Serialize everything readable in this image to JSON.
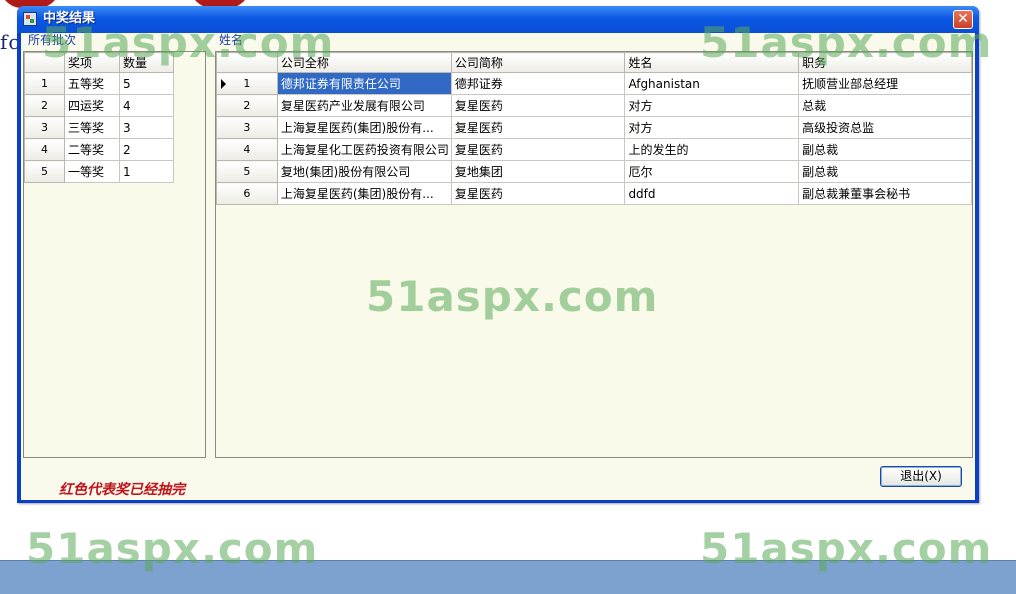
{
  "background": {
    "partial_text": "fc",
    "watermark": "51aspx.com"
  },
  "window": {
    "title": "中奖结果",
    "close_glyph": "✕"
  },
  "labels": {
    "batches": "所有批次",
    "names": "姓名"
  },
  "prize_grid": {
    "columns": [
      "奖项",
      "数量"
    ],
    "rows": [
      {
        "num": "1",
        "prize": "五等奖",
        "count": "5"
      },
      {
        "num": "2",
        "prize": "四运奖",
        "count": "4"
      },
      {
        "num": "3",
        "prize": "三等奖",
        "count": "3"
      },
      {
        "num": "4",
        "prize": "二等奖",
        "count": "2"
      },
      {
        "num": "5",
        "prize": "一等奖",
        "count": "1"
      }
    ]
  },
  "winner_grid": {
    "columns": [
      "公司全称",
      "公司简称",
      "姓名",
      "职务"
    ],
    "rows": [
      {
        "num": "1",
        "full": "德邦证券有限责任公司",
        "short": "德邦证券",
        "name": "Afghanistan",
        "title": "抚顺营业部总经理"
      },
      {
        "num": "2",
        "full": "复星医药产业发展有限公司",
        "short": "复星医药",
        "name": "对方",
        "title": "总裁"
      },
      {
        "num": "3",
        "full": "上海复星医药(集团)股份有...",
        "short": "复星医药",
        "name": "对方",
        "title": "高级投资总监"
      },
      {
        "num": "4",
        "full": "上海复星化工医药投资有限公司",
        "short": "复星医药",
        "name": "上的发生的",
        "title": "副总裁"
      },
      {
        "num": "5",
        "full": "复地(集团)股份有限公司",
        "short": "复地集团",
        "name": " 厄尔",
        "title": "副总裁"
      },
      {
        "num": "6",
        "full": "上海复星医药(集团)股份有...",
        "short": "复星医药",
        "name": "ddfd",
        "title": "副总裁兼董事会秘书"
      }
    ],
    "selected_row": 1
  },
  "footer": {
    "note": "红色代表奖已经抽完",
    "exit_label": "退出(X)"
  },
  "colors": {
    "title_bar": "#0b58e4",
    "selection": "#316ac5",
    "note_red": "#c0141a",
    "watermark_green": "#5aaa5a"
  }
}
